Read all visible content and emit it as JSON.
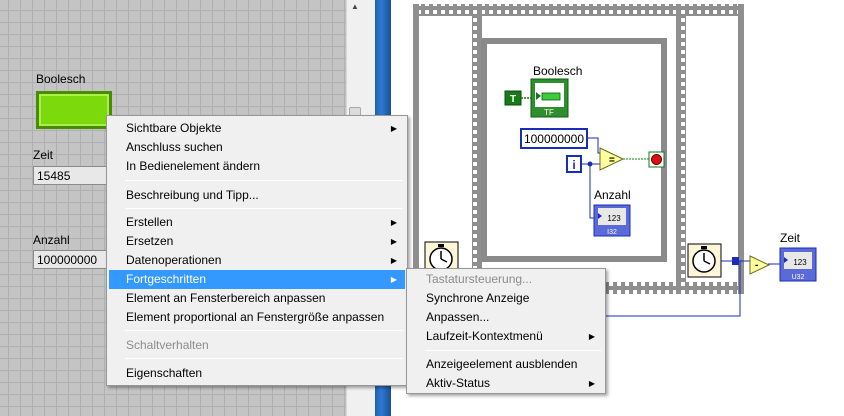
{
  "front_panel": {
    "boolean_label": "Boolesch",
    "time_label": "Zeit",
    "time_value": "15485",
    "count_label": "Anzahl",
    "count_value": "100000000"
  },
  "block_diagram": {
    "boolean_terminal_label": "Boolesch",
    "true_constant": "T",
    "tf_tag": "TF",
    "constant_value": "100000000",
    "iteration_terminal": "i",
    "count_label": "Anzahl",
    "count_indicator": "123",
    "count_type": "I32",
    "time_label": "Zeit",
    "time_indicator": "123",
    "time_type": "U32"
  },
  "context_menu": {
    "items": [
      {
        "label": "Sichtbare Objekte",
        "submenu": true
      },
      {
        "label": "Anschluss suchen"
      },
      {
        "label": "In Bedienelement ändern"
      },
      {
        "label": "Beschreibung und Tipp..."
      },
      {
        "label": "Erstellen",
        "submenu": true
      },
      {
        "label": "Ersetzen",
        "submenu": true
      },
      {
        "label": "Datenoperationen",
        "submenu": true
      },
      {
        "label": "Fortgeschritten",
        "submenu": true
      },
      {
        "label": "Element an Fensterbereich anpassen"
      },
      {
        "label": "Element proportional an Fenstergröße anpassen"
      },
      {
        "label": "Schaltverhalten",
        "disabled": true
      },
      {
        "label": "Eigenschaften"
      }
    ]
  },
  "submenu": {
    "items": [
      {
        "label": "Tastatursteuerung...",
        "disabled": true
      },
      {
        "label": "Synchrone Anzeige"
      },
      {
        "label": "Anpassen..."
      },
      {
        "label": "Laufzeit-Kontextmenü",
        "submenu": true
      },
      {
        "label": "Anzeigeelement ausblenden"
      },
      {
        "label": "Aktiv-Status",
        "submenu": true
      }
    ]
  },
  "colors": {
    "led_on": "#7cd90b",
    "numeric_wire": "#1a2db8",
    "boolean_wire": "#0f7a17",
    "menu_highlight": "#3399ff",
    "stop_terminal": "#d8101a"
  },
  "icons": {
    "submenu_arrow": "triangle-right",
    "wait_timer": "stopwatch",
    "stop_terminal": "stop-circle",
    "compare": "greater-or-equal",
    "subtract": "minus"
  }
}
